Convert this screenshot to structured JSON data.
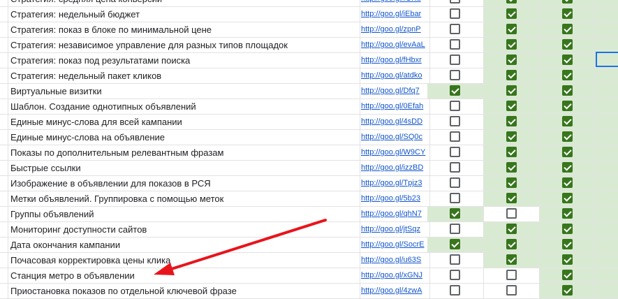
{
  "rows": [
    {
      "name": "Стратегия: средняя цена конверсии",
      "link": "http://goo.gl/fGKu",
      "c3": false,
      "c4": true,
      "c5": true,
      "green3": false,
      "green4": true,
      "green5": true
    },
    {
      "name": "Стратегия: недельный бюджет",
      "link": "http://goo.gl/iEbar",
      "c3": false,
      "c4": true,
      "c5": true,
      "green3": false,
      "green4": true,
      "green5": true
    },
    {
      "name": "Стратегия: показ в блоке по минимальной цене",
      "link": "http://goo.gl/zpnP",
      "c3": false,
      "c4": true,
      "c5": true,
      "green3": false,
      "green4": true,
      "green5": true
    },
    {
      "name": "Стратегия: независимое управление для разных типов площадок",
      "link": "http://goo.gl/evAaL",
      "c3": false,
      "c4": true,
      "c5": true,
      "green3": false,
      "green4": true,
      "green5": true
    },
    {
      "name": "Стратегия: показ под результатами поиска",
      "link": "http://goo.gl/fHbxr",
      "c3": false,
      "c4": true,
      "c5": true,
      "green3": false,
      "green4": true,
      "green5": true
    },
    {
      "name": "Стратегия: недельный пакет кликов",
      "link": "http://goo.gl/atdko",
      "c3": false,
      "c4": true,
      "c5": true,
      "green3": false,
      "green4": true,
      "green5": true
    },
    {
      "name": "Виртуальные визитки",
      "link": "http://goo.gl/Dfq7",
      "c3": true,
      "c4": true,
      "c5": true,
      "green3": true,
      "green4": true,
      "green5": true
    },
    {
      "name": "Шаблон. Создание однотипных объявлений",
      "link": "http://goo.gl/0Efah",
      "c3": false,
      "c4": true,
      "c5": true,
      "green3": false,
      "green4": true,
      "green5": true
    },
    {
      "name": "Единые минус-слова для всей кампании",
      "link": "http://goo.gl/4sDD",
      "c3": false,
      "c4": true,
      "c5": true,
      "green3": false,
      "green4": true,
      "green5": true
    },
    {
      "name": "Единые минус-слова на объявление",
      "link": "http://goo.gl/SQ0c",
      "c3": false,
      "c4": true,
      "c5": true,
      "green3": false,
      "green4": true,
      "green5": true
    },
    {
      "name": "Показы по дополнительным релевантным фразам",
      "link": "http://goo.gl/W9CY",
      "c3": false,
      "c4": true,
      "c5": true,
      "green3": false,
      "green4": true,
      "green5": true
    },
    {
      "name": "Быстрые ссылки",
      "link": "http://goo.gl/izzBD",
      "c3": false,
      "c4": true,
      "c5": true,
      "green3": false,
      "green4": true,
      "green5": true
    },
    {
      "name": "Изображение в объявлении для показов в РСЯ",
      "link": "http://goo.gl/Tpjz3",
      "c3": false,
      "c4": true,
      "c5": true,
      "green3": false,
      "green4": true,
      "green5": true
    },
    {
      "name": "Метки объявлений. Группировка с помощью меток",
      "link": "http://goo.gl/5b23",
      "c3": false,
      "c4": true,
      "c5": true,
      "green3": false,
      "green4": true,
      "green5": true
    },
    {
      "name": "Группы объявлений",
      "link": "http://goo.gl/qhN7",
      "c3": true,
      "c4": false,
      "c5": true,
      "green3": true,
      "green4": false,
      "green5": true
    },
    {
      "name": "Мониторинг доступности сайтов",
      "link": "http://goo.gl/jtSqz",
      "c3": false,
      "c4": true,
      "c5": true,
      "green3": false,
      "green4": true,
      "green5": true
    },
    {
      "name": "Дата окончания кампании",
      "link": "http://goo.gl/SocrE",
      "c3": true,
      "c4": true,
      "c5": true,
      "green3": true,
      "green4": true,
      "green5": true
    },
    {
      "name": "Почасовая корректировка цены клика",
      "link": "http://goo.gl/u63S",
      "c3": false,
      "c4": true,
      "c5": true,
      "green3": false,
      "green4": true,
      "green5": true
    },
    {
      "name": "Станция метро в объявлении",
      "link": "http://goo.gl/xGNJ",
      "c3": false,
      "c4": false,
      "c5": true,
      "green3": false,
      "green4": false,
      "green5": true
    },
    {
      "name": "Приостановка показов по отдельной ключевой фразе",
      "link": "http://goo.gl/4zwA",
      "c3": false,
      "c4": false,
      "c5": true,
      "green3": false,
      "green4": false,
      "green5": true
    }
  ],
  "colors": {
    "checked": "#38761d",
    "green_fill": "#d9ead3",
    "link": "#1155cc",
    "arrow": "#e8141c",
    "selection": "#1a73e8"
  }
}
